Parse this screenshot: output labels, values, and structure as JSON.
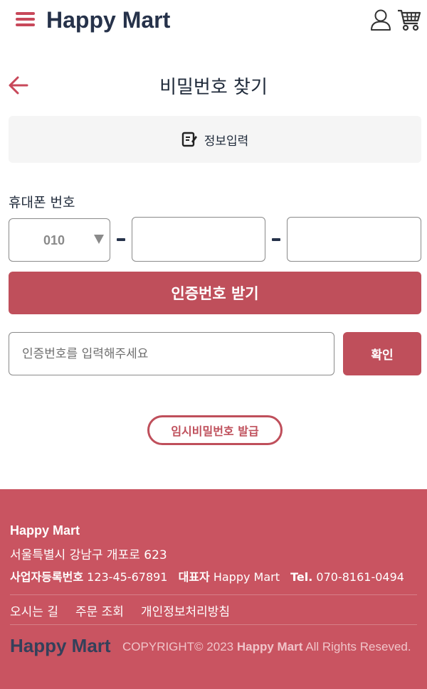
{
  "header": {
    "brand": "Happy Mart",
    "icons": {
      "menu": "menu-icon",
      "user": "user-icon",
      "cart": "cart-icon"
    }
  },
  "page": {
    "title": "비밀번호 찾기",
    "back_icon": "arrow-left-icon"
  },
  "step": {
    "icon": "edit-note-icon",
    "label": "정보입력"
  },
  "form": {
    "phone_label": "휴대폰 번호",
    "prefix_value": "010",
    "middle_value": "",
    "last_value": "",
    "send_code_label": "인증번호 받기",
    "code_placeholder": "인증번호를 입력해주세요",
    "confirm_label": "확인",
    "temp_password_label": "임시비밀번호 발급"
  },
  "footer": {
    "brand": "Happy Mart",
    "address": "서울특별시 강남구 개포로 623",
    "biz_label": "사업자등록번호",
    "biz_number": "123-45-67891",
    "rep_label": "대표자",
    "rep_name": "Happy Mart",
    "tel_label": "Tel.",
    "tel_number": "070-8161-0494",
    "links": [
      "오시는 길",
      "주문 조회",
      "개인정보처리방침"
    ],
    "logo": "Happy Mart",
    "copyright_prefix": "COPYRIGHT© 2023",
    "copyright_brand": "Happy Mart",
    "copyright_suffix": "All Rights Reseved."
  },
  "colors": {
    "accent": "#bf4f5b",
    "footer_bg": "#c95461",
    "brand_text": "#26324a"
  }
}
